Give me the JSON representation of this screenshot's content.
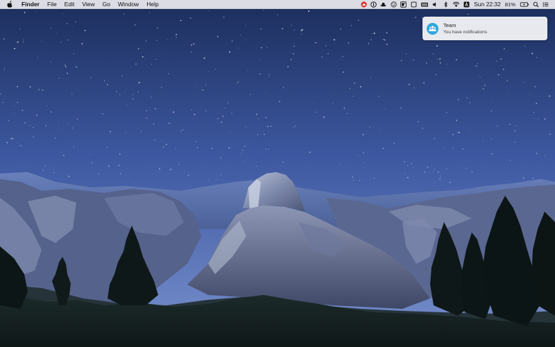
{
  "menubar": {
    "apple_icon": "apple-icon",
    "app_name": "Finder",
    "items": [
      "File",
      "Edit",
      "View",
      "Go",
      "Window",
      "Help"
    ],
    "status_icons": [
      "red-cloud-icon",
      "onepassword-icon",
      "hat-icon",
      "emoji-icon",
      "browser-icon",
      "crop-icon",
      "display-icon",
      "volume-icon",
      "bluetooth-icon",
      "wifi-icon",
      "input-a-icon"
    ],
    "clock": "Sun 22:32",
    "battery_percent": "81%",
    "battery_icon": "battery-charging-icon",
    "search_icon": "search-icon",
    "notification_center_icon": "list-icon"
  },
  "notification": {
    "icon": "team-icon",
    "title": "Team",
    "body": "You have notifications",
    "accent": "#2fa8de"
  },
  "wallpaper": {
    "sky_top": "#1a2d5c",
    "sky_bottom": "#6f88c8",
    "subject": "night-mountains"
  }
}
